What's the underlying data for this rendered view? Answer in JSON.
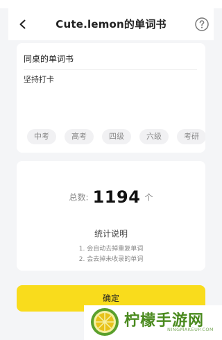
{
  "header": {
    "title": "Cute.lemon的单词书"
  },
  "notebook": {
    "name": "同桌的单词书",
    "description": "坚持打卡",
    "tags": [
      "中考",
      "高考",
      "四级",
      "六级",
      "考研"
    ]
  },
  "stats": {
    "total_label": "总数:",
    "total_value": "1194",
    "total_unit": "个",
    "title": "统计说明",
    "notes": [
      "1. 会自动去掉重复单词",
      "2. 会去掉未收录的单词"
    ]
  },
  "confirm_label": "确定",
  "watermark": {
    "text": "柠檬手游网",
    "sub": "NINGMAKEUP.COM"
  },
  "colors": {
    "accent": "#f9dc1c",
    "watermark_green": "#4a8a1e"
  }
}
